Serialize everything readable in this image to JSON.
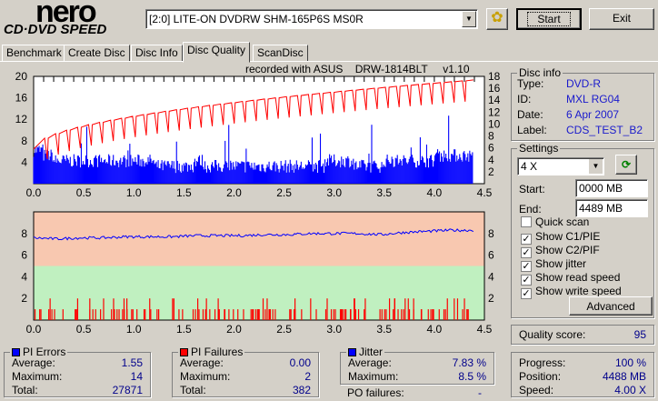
{
  "app": {
    "logo_top": "nero",
    "logo_bottom": "CD·DVD SPEED"
  },
  "toolbar": {
    "drive": "[2:0]  LITE-ON DVDRW SHM-165P6S MS0R",
    "start": "Start",
    "exit": "Exit"
  },
  "tabs": [
    {
      "label": "Benchmark"
    },
    {
      "label": "Create Disc"
    },
    {
      "label": "Disc Info"
    },
    {
      "label": "Disc Quality",
      "active": true
    },
    {
      "label": "ScanDisc"
    }
  ],
  "recorded": "recorded with ASUS    DRW-1814BLT     v1.10",
  "disc_info": {
    "title": "Disc info",
    "type_label": "Type:",
    "type": "DVD-R",
    "id_label": "ID:",
    "id": "MXL RG04",
    "date_label": "Date:",
    "date": "6 Apr 2007",
    "label_label": "Label:",
    "label": "CDS_TEST_B2"
  },
  "settings": {
    "title": "Settings",
    "speed": "4 X",
    "start_label": "Start:",
    "start": "0000 MB",
    "end_label": "End:",
    "end": "4489 MB",
    "checks": [
      {
        "label": "Quick scan",
        "checked": false
      },
      {
        "label": "Show C1/PIE",
        "checked": true
      },
      {
        "label": "Show C2/PIF",
        "checked": true
      },
      {
        "label": "Show jitter",
        "checked": true
      },
      {
        "label": "Show read speed",
        "checked": true
      },
      {
        "label": "Show write speed",
        "checked": true
      }
    ],
    "advanced": "Advanced"
  },
  "quality": {
    "label": "Quality score:",
    "value": "95"
  },
  "pi_errors": {
    "title": "PI Errors",
    "avg_label": "Average:",
    "avg": "1.55",
    "max_label": "Maximum:",
    "max": "14",
    "total_label": "Total:",
    "total": "27871"
  },
  "pi_failures": {
    "title": "PI Failures",
    "avg_label": "Average:",
    "avg": "0.00",
    "max_label": "Maximum:",
    "max": "2",
    "total_label": "Total:",
    "total": "382"
  },
  "jitter": {
    "title": "Jitter",
    "avg_label": "Average:",
    "avg": "7.83 %",
    "max_label": "Maximum:",
    "max": "8.5 %",
    "po_label": "PO failures:",
    "po": "-"
  },
  "progress": {
    "progress_label": "Progress:",
    "progress": "100 %",
    "position_label": "Position:",
    "position": "4488 MB",
    "speed_label": "Speed:",
    "speed": "4.00 X"
  },
  "colors": {
    "pie": "#0000ff",
    "pif": "#ff0000",
    "speed": "#ff0000",
    "jitter": "#0000ff",
    "top_bg": "#ffffff",
    "bad_bg": "#f8c8b0",
    "good_bg": "#c0f0c0"
  },
  "chart_data": [
    {
      "type": "bar",
      "title": "PI Errors / Read speed",
      "xlim": [
        0,
        4.5
      ],
      "ylim": [
        0,
        20
      ],
      "y2lim": [
        0,
        18
      ],
      "x_ticks": [
        "0.0",
        "0.5",
        "1.0",
        "1.5",
        "2.0",
        "2.5",
        "3.0",
        "3.5",
        "4.0",
        "4.5"
      ],
      "y_ticks": [
        "20",
        "16",
        "12",
        "8",
        "4"
      ],
      "y2_ticks": [
        "18",
        "16",
        "14",
        "12",
        "10",
        "8",
        "6",
        "4",
        "2"
      ],
      "pie_level": [
        5,
        4,
        3,
        3,
        3,
        3,
        3,
        3,
        3,
        3,
        3,
        3,
        2,
        2,
        2,
        2,
        3,
        2,
        2,
        2,
        2,
        2,
        2,
        2,
        2,
        2,
        2,
        2,
        2,
        3,
        3,
        3,
        2,
        2,
        2,
        3,
        3,
        3,
        3,
        3,
        4,
        4,
        4,
        4
      ],
      "speed_start": 5.8,
      "speed_end": 17.4
    },
    {
      "type": "bar",
      "title": "PI Failures / Jitter",
      "xlim": [
        0,
        4.5
      ],
      "ylim": [
        0,
        10
      ],
      "y2lim": [
        0,
        10
      ],
      "x_ticks": [
        "0.0",
        "0.5",
        "1.0",
        "1.5",
        "2.0",
        "2.5",
        "3.0",
        "3.5",
        "4.0",
        "4.5"
      ],
      "y_ticks": [
        "8",
        "6",
        "4",
        "2"
      ],
      "y2_ticks": [
        "8",
        "6",
        "4",
        "2"
      ],
      "jitter": [
        7.6,
        7.5,
        7.6,
        7.6,
        7.7,
        7.7,
        7.7,
        7.8,
        7.8,
        7.8,
        7.9,
        7.9,
        8.0,
        8.0,
        8.0,
        7.9,
        8.1,
        8.2,
        8.3,
        8.3
      ]
    }
  ]
}
